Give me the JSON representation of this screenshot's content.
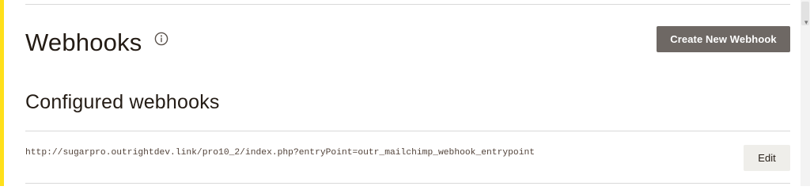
{
  "header": {
    "title": "Webhooks",
    "info_icon": "info-circle-icon",
    "create_button_label": "Create New Webhook"
  },
  "section": {
    "title": "Configured webhooks"
  },
  "webhooks": [
    {
      "url": "http://sugarpro.outrightdev.link/pro10_2/index.php?entryPoint=outr_mailchimp_webhook_entrypoint",
      "edit_label": "Edit"
    }
  ],
  "colors": {
    "accent": "#ffe01b",
    "primary_button": "#6e6864",
    "secondary_button": "#efeeea",
    "text": "#241c15",
    "url_text": "#52433a",
    "divider": "#d9d9d9"
  }
}
